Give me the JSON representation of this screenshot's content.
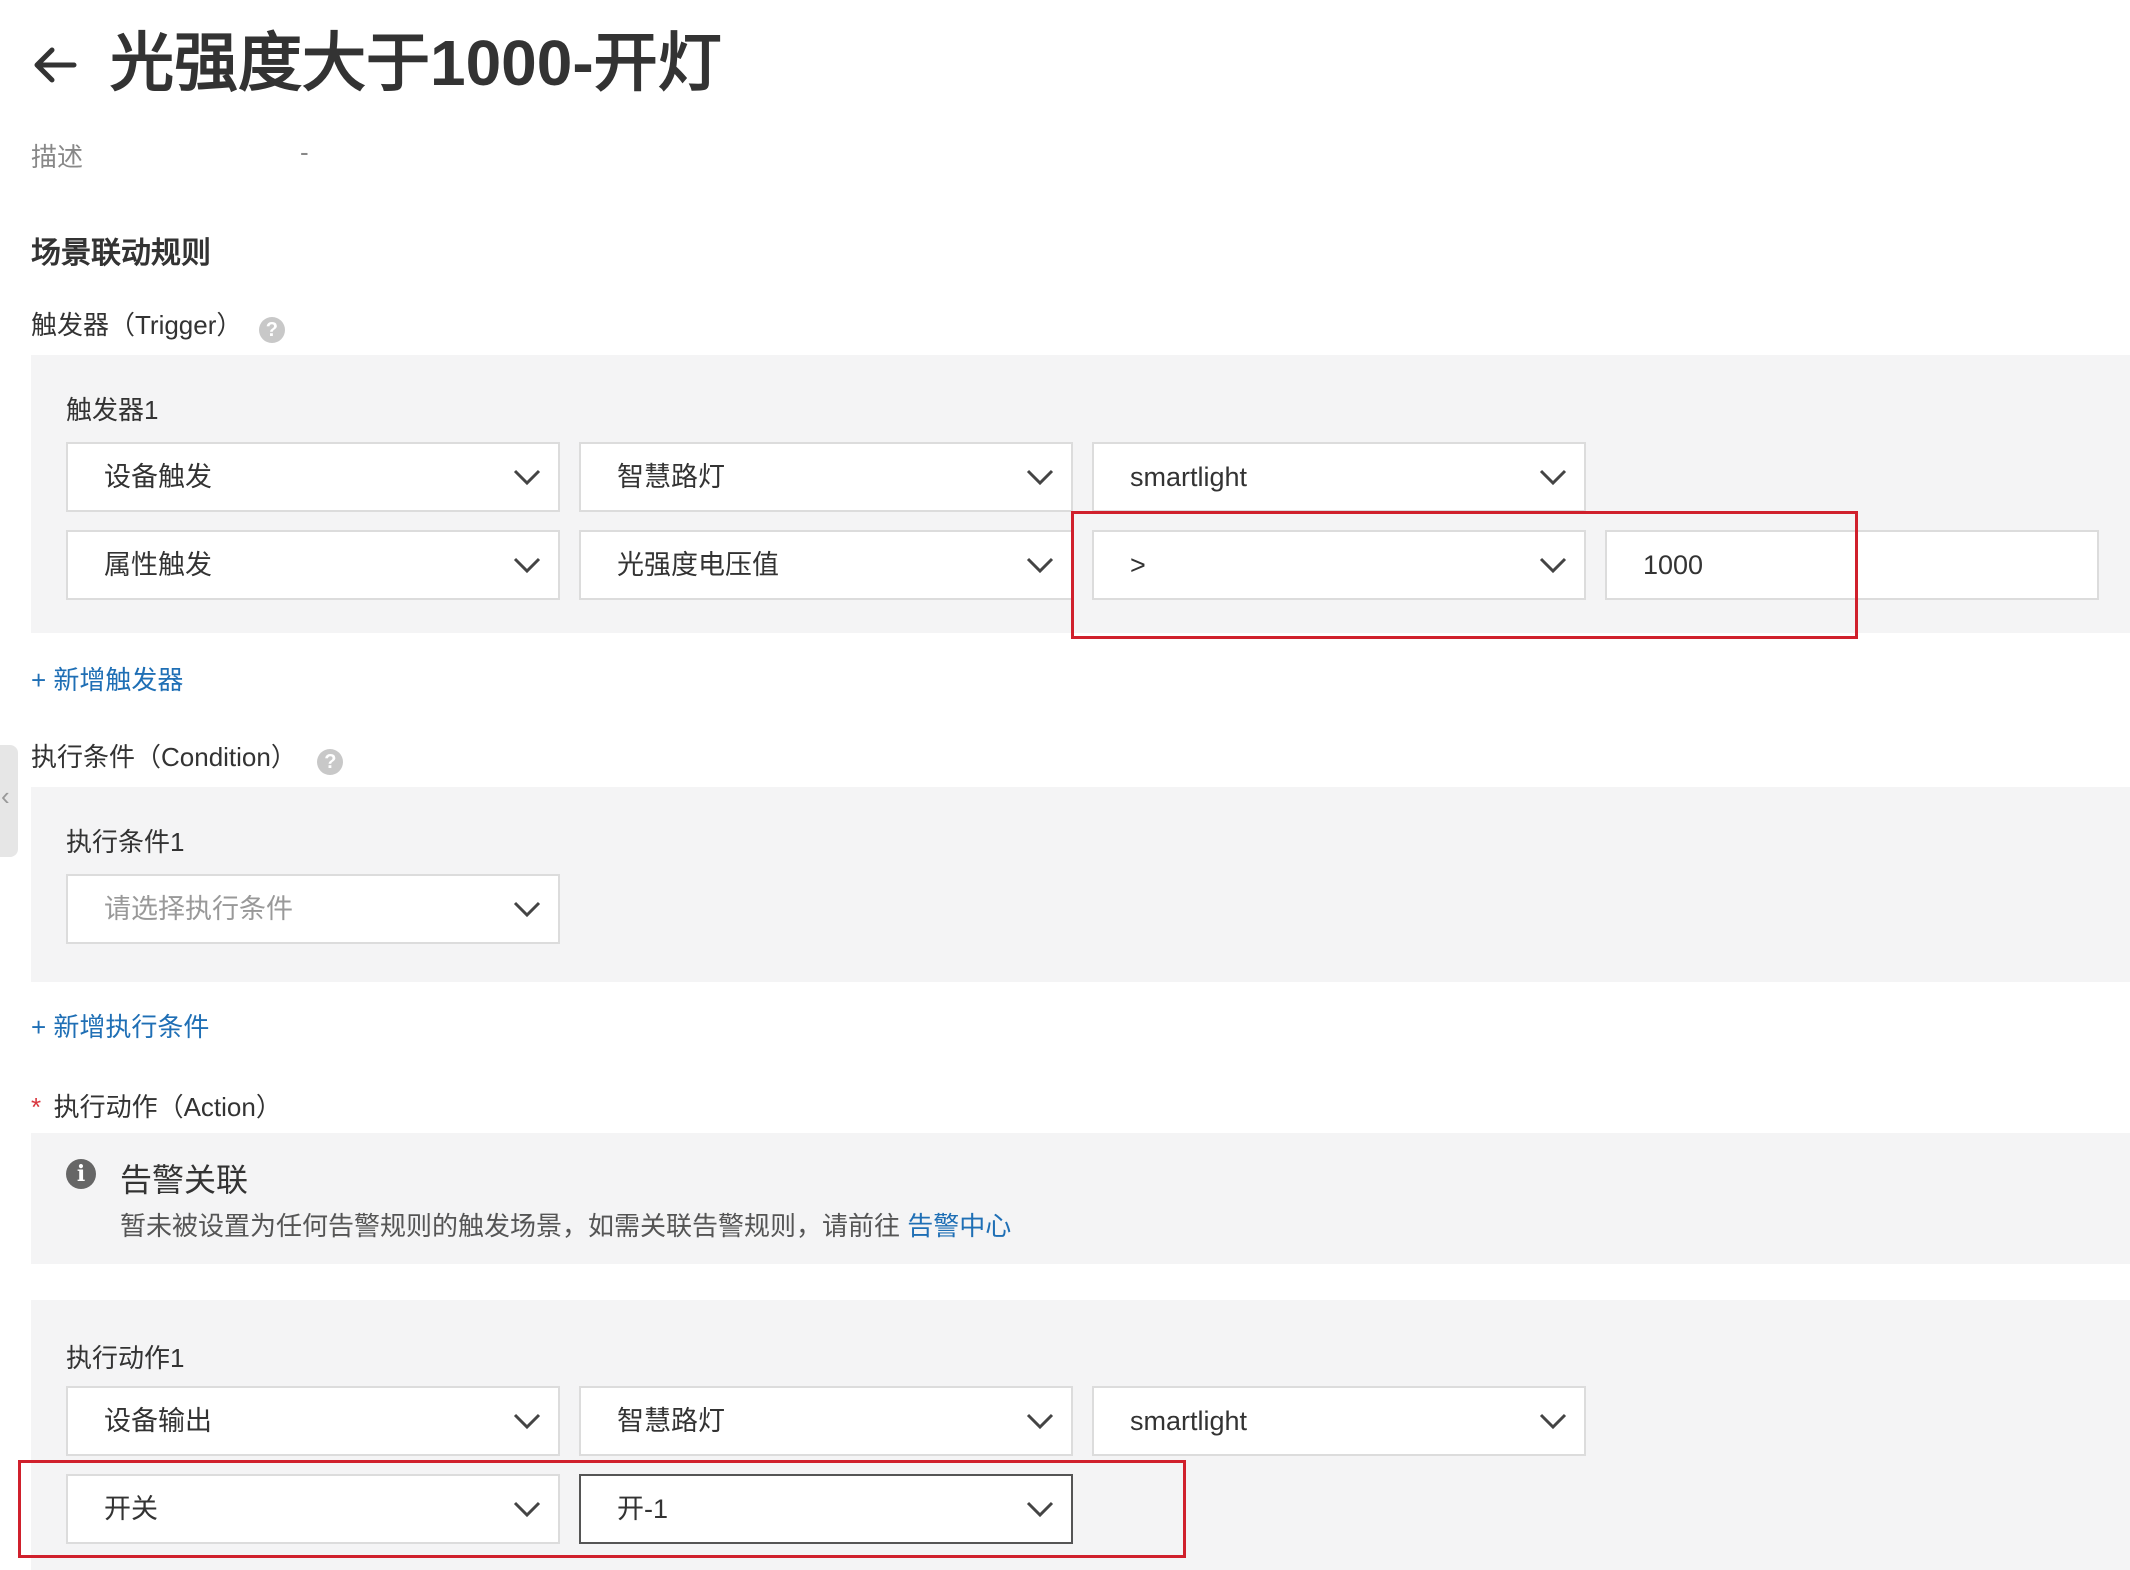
{
  "header": {
    "back_icon": "arrow-left-icon",
    "title": "光强度大于1000-开灯"
  },
  "description": {
    "label": "描述",
    "value": "-"
  },
  "rules": {
    "section_title": "场景联动规则",
    "trigger": {
      "label": "触发器（Trigger）",
      "help": "?",
      "panel_title": "触发器1",
      "row1": [
        "设备触发",
        "智慧路灯",
        "smartlight"
      ],
      "row2": {
        "type": "属性触发",
        "property": "光强度电压值",
        "operator": ">",
        "value": "1000"
      },
      "add_label": "+ 新增触发器"
    },
    "condition": {
      "label": "执行条件（Condition）",
      "help": "?",
      "panel_title": "执行条件1",
      "placeholder": "请选择执行条件",
      "add_label": "+ 新增执行条件"
    },
    "action": {
      "required_mark": "*",
      "label": "执行动作（Action）",
      "notice": {
        "icon": "info-icon",
        "title": "告警关联",
        "text": "暂未被设置为任何告警规则的触发场景，如需关联告警规则，请前往",
        "link": "告警中心"
      },
      "panel_title": "执行动作1",
      "row1": [
        "设备输出",
        "智慧路灯",
        "smartlight"
      ],
      "row2": [
        "开关",
        "开-1"
      ]
    }
  },
  "colors": {
    "link": "#1f6fb5",
    "highlight_box": "#d0202c",
    "panel_bg": "#f4f4f5"
  }
}
